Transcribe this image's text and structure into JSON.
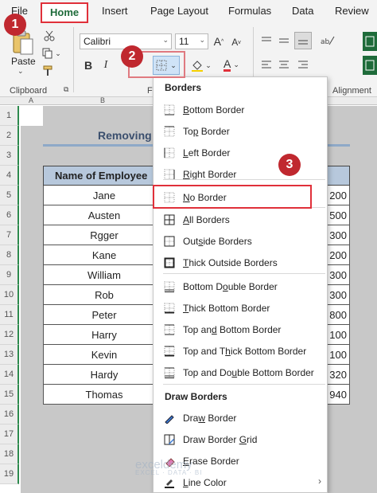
{
  "ribbon": {
    "tabs": [
      "File",
      "Home",
      "Insert",
      "Page Layout",
      "Formulas",
      "Data",
      "Review"
    ],
    "active_tab": "Home",
    "paste_label": "Paste",
    "clipboard_label": "Clipboard",
    "font_group_label": "F",
    "alignment_label": "Alignment",
    "font_name": "Calibri",
    "font_size": "11",
    "bold": "B",
    "italic": "I",
    "grow_font": "A",
    "shrink_font": "A",
    "font_color": "A",
    "accent_red": "#e0303a",
    "step_badges": [
      "1",
      "2",
      "3"
    ]
  },
  "sheet": {
    "columns": [
      "A",
      "B"
    ],
    "rows": [
      "1",
      "2",
      "3",
      "4",
      "5",
      "6",
      "7",
      "8",
      "9",
      "10",
      "11",
      "12",
      "13",
      "14",
      "15",
      "16",
      "17",
      "18",
      "19"
    ],
    "title": "Removing",
    "header_name": "Name of Employee",
    "employees": [
      "Jane",
      "Austen",
      "Rgger",
      "Kane",
      "William",
      "Rob",
      "Peter",
      "Harry",
      "Kevin",
      "Hardy",
      "Thomas"
    ],
    "values": [
      "200",
      "500",
      "300",
      "200",
      "300",
      "300",
      "800",
      "100",
      "100",
      "320",
      "940"
    ]
  },
  "menu": {
    "borders_header": "Borders",
    "draw_header": "Draw Borders",
    "items_borders": [
      {
        "pre": "",
        "key": "B",
        "post": "ottom Border",
        "icon": "bottom-border-icon"
      },
      {
        "pre": "To",
        "key": "p",
        "post": " Border",
        "icon": "top-border-icon"
      },
      {
        "pre": "",
        "key": "L",
        "post": "eft Border",
        "icon": "left-border-icon"
      },
      {
        "pre": "",
        "key": "R",
        "post": "ight Border",
        "icon": "right-border-icon"
      },
      {
        "pre": "",
        "key": "N",
        "post": "o Border",
        "icon": "no-border-icon"
      },
      {
        "pre": "",
        "key": "A",
        "post": "ll Borders",
        "icon": "all-borders-icon"
      },
      {
        "pre": "Out",
        "key": "s",
        "post": "ide Borders",
        "icon": "outside-borders-icon"
      },
      {
        "pre": "",
        "key": "T",
        "post": "hick Outside Borders",
        "icon": "thick-outside-borders-icon"
      },
      {
        "pre": "Bottom D",
        "key": "o",
        "post": "uble Border",
        "icon": "bottom-double-border-icon"
      },
      {
        "pre": "",
        "key": "T",
        "post": "hick Bottom Border",
        "icon": "thick-bottom-border-icon"
      },
      {
        "pre": "Top an",
        "key": "d",
        "post": " Bottom Border",
        "icon": "top-and-bottom-border-icon"
      },
      {
        "pre": "Top and T",
        "key": "h",
        "post": "ick Bottom Border",
        "icon": "top-thick-bottom-border-icon"
      },
      {
        "pre": "Top and Do",
        "key": "u",
        "post": "ble Bottom Border",
        "icon": "top-double-bottom-border-icon"
      }
    ],
    "items_draw": [
      {
        "pre": "Dra",
        "key": "w",
        "post": " Border",
        "icon": "draw-border-icon"
      },
      {
        "pre": "Draw Border ",
        "key": "G",
        "post": "rid",
        "icon": "draw-border-grid-icon"
      },
      {
        "pre": "",
        "key": "E",
        "post": "rase Border",
        "icon": "eraser-icon"
      },
      {
        "pre": "",
        "key": "L",
        "post": "ine Color",
        "icon": "line-color-icon"
      }
    ],
    "submenu_arrow": "›"
  },
  "watermark": {
    "name": "exceldemy",
    "tagline": "EXCEL · DATA · BI"
  }
}
